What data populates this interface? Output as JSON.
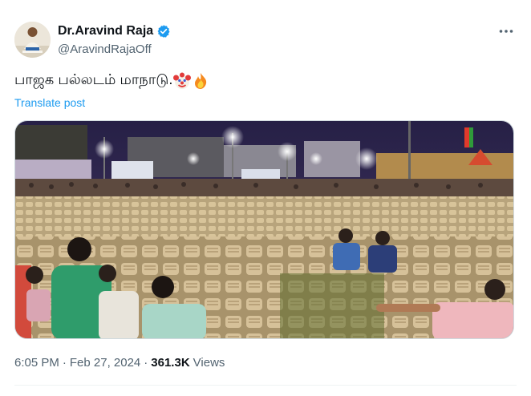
{
  "author": {
    "display_name": "Dr.Aravind Raja",
    "handle": "@AravindRajaOff",
    "verified": true
  },
  "tweet": {
    "text": "பாஜக பல்லடம் மாநாடு.",
    "emojis": [
      "clown-face-icon",
      "fire-icon"
    ],
    "translate_label": "Translate post"
  },
  "media": {
    "kind": "photo",
    "subject": "rows of empty plastic chairs at a night event ground"
  },
  "meta": {
    "time": "6:05 PM",
    "separator": "·",
    "date": "Feb 27, 2024",
    "views_count": "361.3K",
    "views_label": "Views"
  },
  "colors": {
    "accent": "#1d9bf0",
    "text_primary": "#0f1419",
    "text_secondary": "#536471",
    "chair": "#cdb68a"
  }
}
